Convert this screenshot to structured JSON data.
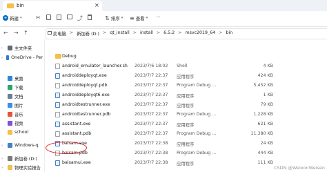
{
  "window": {
    "tab_title": "bin",
    "tab_close": "×"
  },
  "toolbar": {
    "new_label": "新建",
    "new_caret": "▾",
    "sort_label": "排序",
    "view_label": "查看",
    "more_label": "···"
  },
  "nav": {
    "back": "←",
    "forward": "→",
    "up": "↑"
  },
  "breadcrumb": [
    "此电脑",
    "新加卷 (D:)",
    "qt_install",
    "install",
    "6.5.2",
    "msvc2019_64",
    "bin"
  ],
  "breadcrumb_sep": ">",
  "sidebar": {
    "items": [
      {
        "label": "主文件夹",
        "icon": "home-icon",
        "color": "#5f6b7a"
      },
      {
        "label": "OneDrive - Per",
        "icon": "cloud-icon",
        "color": "#2f7ad6"
      },
      {
        "label": "桌面",
        "icon": "desktop-icon",
        "color": "#2f86d6"
      },
      {
        "label": "下载",
        "icon": "download-icon",
        "color": "#2aa56b"
      },
      {
        "label": "文档",
        "icon": "document-icon",
        "color": "#6b7c93"
      },
      {
        "label": "图片",
        "icon": "picture-icon",
        "color": "#3a8ee6"
      },
      {
        "label": "音乐",
        "icon": "music-icon",
        "color": "#e2553a"
      },
      {
        "label": "视频",
        "icon": "video-icon",
        "color": "#8a4fd0"
      },
      {
        "label": "school",
        "icon": "folder-icon",
        "color": "#f4c04a"
      },
      {
        "label": "Windows-q",
        "icon": "drive-icon",
        "color": "#4a7fc1"
      },
      {
        "label": "新加卷 (D:)",
        "icon": "drive-icon",
        "color": "#7a7a7a"
      },
      {
        "label": "物理实验报告",
        "icon": "folder-icon",
        "color": "#f4c04a"
      }
    ]
  },
  "files": [
    {
      "name": "Debug",
      "date": "",
      "type": "",
      "size": "",
      "icon": "folder-icon"
    },
    {
      "name": "android_emulator_launcher.sh",
      "date": "2023/7/6 18:02",
      "type": "Shell",
      "size": "4 KB",
      "icon": "file-icon"
    },
    {
      "name": "androiddeployqt.exe",
      "date": "2023/7/7 22:37",
      "type": "应用程序",
      "size": "424 KB",
      "icon": "exe-icon"
    },
    {
      "name": "androiddeployqt.pdb",
      "date": "2023/7/7 22:37",
      "type": "Program Debug ...",
      "size": "5,452 KB",
      "icon": "file-icon"
    },
    {
      "name": "androiddeployqt6.exe",
      "date": "2023/7/7 22:37",
      "type": "应用程序",
      "size": "1 KB",
      "icon": "exe-icon"
    },
    {
      "name": "androidtestrunner.exe",
      "date": "2023/7/7 22:37",
      "type": "应用程序",
      "size": "79 KB",
      "icon": "exe-icon"
    },
    {
      "name": "androidtestrunner.pdb",
      "date": "2023/7/7 22:37",
      "type": "Program Debug ...",
      "size": "1,228 KB",
      "icon": "file-icon"
    },
    {
      "name": "assistant.exe",
      "date": "2023/7/7 22:37",
      "type": "应用程序",
      "size": "621 KB",
      "icon": "exe-icon"
    },
    {
      "name": "assistant.pdb",
      "date": "2023/7/7 22:37",
      "type": "Program Debug ...",
      "size": "11,380 KB",
      "icon": "file-icon"
    },
    {
      "name": "balsam.exe",
      "date": "2023/7/7 22:38",
      "type": "应用程序",
      "size": "24 KB",
      "icon": "exe-icon"
    },
    {
      "name": "balsam.pdb",
      "date": "2023/7/7 22:38",
      "type": "Program Debug ...",
      "size": "444 KB",
      "icon": "file-icon"
    },
    {
      "name": "balsamui.exe",
      "date": "2023/7/7 22:38",
      "type": "应用程序",
      "size": "111 KB",
      "icon": "exe-icon"
    }
  ],
  "watermark": "CSDN @WeixonWeisen"
}
